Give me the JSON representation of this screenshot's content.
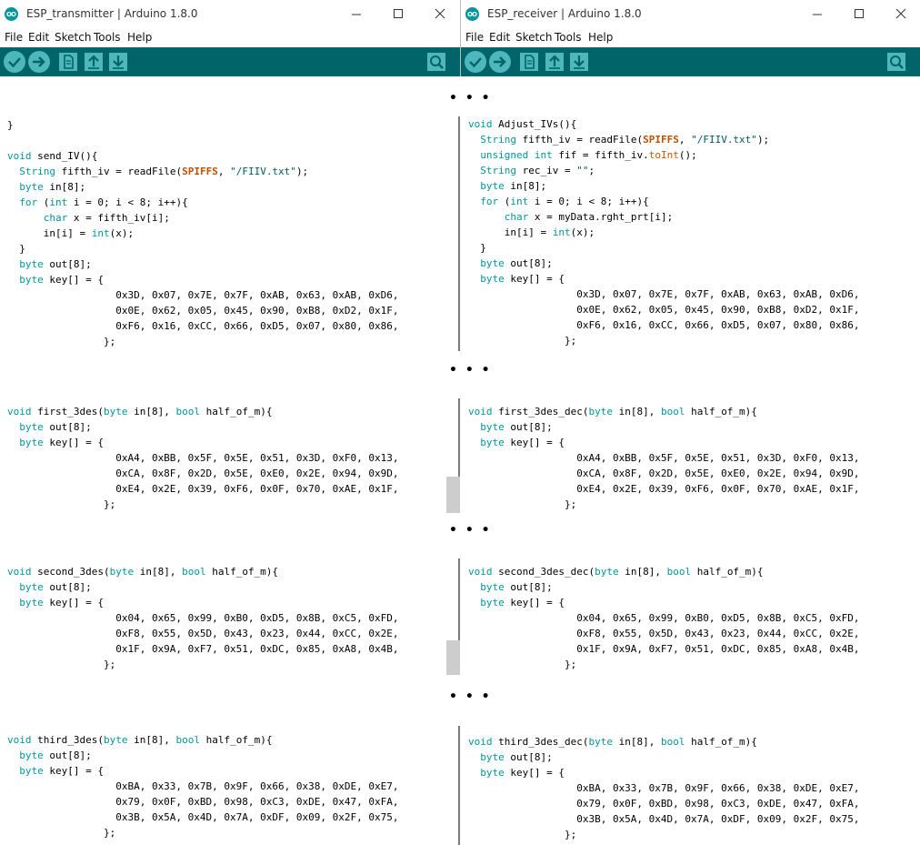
{
  "left_window": {
    "title": "ESP_transmitter | Arduino 1.8.0",
    "menu": [
      "File",
      "Edit",
      "Sketch",
      "Tools",
      "Help"
    ]
  },
  "right_window": {
    "title": "ESP_receiver | Arduino 1.8.0",
    "menu": [
      "File",
      "Edit",
      "Sketch",
      "Tools",
      "Help"
    ]
  },
  "ellipsis": "• • •",
  "icons": [
    "verify-icon",
    "upload-icon",
    "new-icon",
    "open-icon",
    "save-icon",
    "serial-monitor-icon",
    "minimize-icon",
    "maximize-icon",
    "close-icon"
  ],
  "colors": {
    "toolbar": "#006468",
    "button": "#4db7bb",
    "keyword": "#00979c",
    "function": "#d35400"
  },
  "left_code": {
    "block1": "}\n\nvoid send_IV(){\n  String fifth_iv = readFile(SPIFFS, \"/FIIV.txt\");\n  byte in[8];\n  for (int i = 0; i < 8; i++){\n      char x = fifth_iv[i];\n      in[i] = int(x);\n  }\n  byte out[8];\n  byte key[] = {\n                  0x3D, 0x07, 0x7E, 0x7F, 0xAB, 0x63, 0xAB, 0xD6,\n                  0x0E, 0x62, 0x05, 0x45, 0x90, 0xB8, 0xD2, 0x1F,\n                  0xF6, 0x16, 0xCC, 0x66, 0xD5, 0x07, 0x80, 0x86,\n                };",
    "block2": "void first_3des(byte in[8], bool half_of_m){\n  byte out[8];\n  byte key[] = {\n                  0xA4, 0xBB, 0x5F, 0x5E, 0x51, 0x3D, 0xF0, 0x13,\n                  0xCA, 0x8F, 0x2D, 0x5E, 0xE0, 0x2E, 0x94, 0x9D,\n                  0xE4, 0x2E, 0x39, 0xF6, 0x0F, 0x70, 0xAE, 0x1F,\n                };",
    "block3": "void second_3des(byte in[8], bool half_of_m){\n  byte out[8];\n  byte key[] = {\n                  0x04, 0x65, 0x99, 0xB0, 0xD5, 0x8B, 0xC5, 0xFD,\n                  0xF8, 0x55, 0x5D, 0x43, 0x23, 0x44, 0xCC, 0x2E,\n                  0x1F, 0x9A, 0xF7, 0x51, 0xDC, 0x85, 0xA8, 0x4B,\n                };",
    "block4": "void third_3des(byte in[8], bool half_of_m){\n  byte out[8];\n  byte key[] = {\n                  0xBA, 0x33, 0x7B, 0x9F, 0x66, 0x38, 0xDE, 0xE7,\n                  0x79, 0x0F, 0xBD, 0x98, 0xC3, 0xDE, 0x47, 0xFA,\n                  0x3B, 0x5A, 0x4D, 0x7A, 0xDF, 0x09, 0x2F, 0x75,\n                };"
  },
  "right_code": {
    "block1": "void Adjust_IVs(){\n  String fifth_iv = readFile(SPIFFS, \"/FIIV.txt\");\n  unsigned int fif = fifth_iv.toInt();\n  String rec_iv = \"\";\n  byte in[8];\n  for (int i = 0; i < 8; i++){\n      char x = myData.rght_prt[i];\n      in[i] = int(x);\n  }\n  byte out[8];\n  byte key[] = {\n                  0x3D, 0x07, 0x7E, 0x7F, 0xAB, 0x63, 0xAB, 0xD6,\n                  0x0E, 0x62, 0x05, 0x45, 0x90, 0xB8, 0xD2, 0x1F,\n                  0xF6, 0x16, 0xCC, 0x66, 0xD5, 0x07, 0x80, 0x86,\n                };",
    "block2": "void first_3des_dec(byte in[8], bool half_of_m){\n  byte out[8];\n  byte key[] = {\n                  0xA4, 0xBB, 0x5F, 0x5E, 0x51, 0x3D, 0xF0, 0x13,\n                  0xCA, 0x8F, 0x2D, 0x5E, 0xE0, 0x2E, 0x94, 0x9D,\n                  0xE4, 0x2E, 0x39, 0xF6, 0x0F, 0x70, 0xAE, 0x1F,\n                };",
    "block3": "void second_3des_dec(byte in[8], bool half_of_m){\n  byte out[8];\n  byte key[] = {\n                  0x04, 0x65, 0x99, 0xB0, 0xD5, 0x8B, 0xC5, 0xFD,\n                  0xF8, 0x55, 0x5D, 0x43, 0x23, 0x44, 0xCC, 0x2E,\n                  0x1F, 0x9A, 0xF7, 0x51, 0xDC, 0x85, 0xA8, 0x4B,\n                };",
    "block4": "void third_3des_dec(byte in[8], bool half_of_m){\n  byte out[8];\n  byte key[] = {\n                  0xBA, 0x33, 0x7B, 0x9F, 0x66, 0x38, 0xDE, 0xE7,\n                  0x79, 0x0F, 0xBD, 0x98, 0xC3, 0xDE, 0x47, 0xFA,\n                  0x3B, 0x5A, 0x4D, 0x7A, 0xDF, 0x09, 0x2F, 0x75,\n                };"
  }
}
